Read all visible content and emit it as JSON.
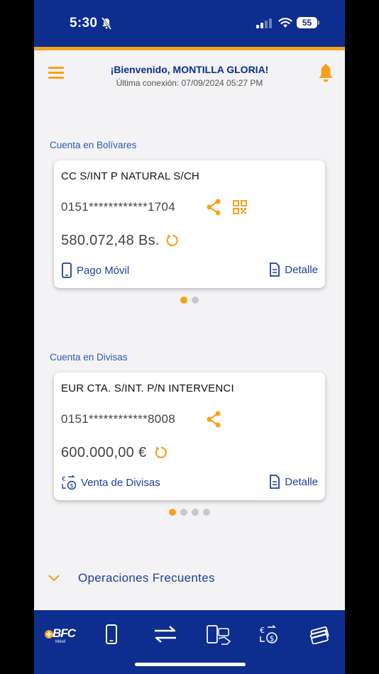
{
  "status": {
    "time": "5:30",
    "battery": "55"
  },
  "header": {
    "welcome": "¡Bienvenido, MONTILLA GLORIA!",
    "last_connection": "Última conexión: 07/09/2024 05:27 PM"
  },
  "accounts_bs": {
    "section_label": "Cuenta en Bolívares",
    "name": "CC S/INT P NATURAL S/CH",
    "number": "0151************1704",
    "balance": "580.072,48 Bs.",
    "left_action": "Pago Móvil",
    "right_action": "Detalle"
  },
  "accounts_fx": {
    "section_label": "Cuenta en Divisas",
    "name": "EUR CTA. S/INT. P/N INTERVENCI",
    "number": "0151************8008",
    "balance": "600.000,00 €",
    "left_action": "Venta de Divisas",
    "right_action": "Detalle"
  },
  "frequent": {
    "label": "Operaciones Frecuentes"
  },
  "bottom_nav": {
    "logo_text": "BFC",
    "logo_sub": "Móvil",
    "items": [
      "bfc-logo",
      "mobile-phone-icon",
      "transfer-arrows-icon",
      "mobile-payment-icon",
      "currency-exchange-icon",
      "cards-icon"
    ]
  },
  "colors": {
    "primary": "#0d2d8f",
    "accent": "#f5a21b",
    "link": "#1e3f99"
  },
  "carousel": {
    "bs_dots": 2,
    "bs_active": 0,
    "fx_dots": 4,
    "fx_active": 0
  }
}
